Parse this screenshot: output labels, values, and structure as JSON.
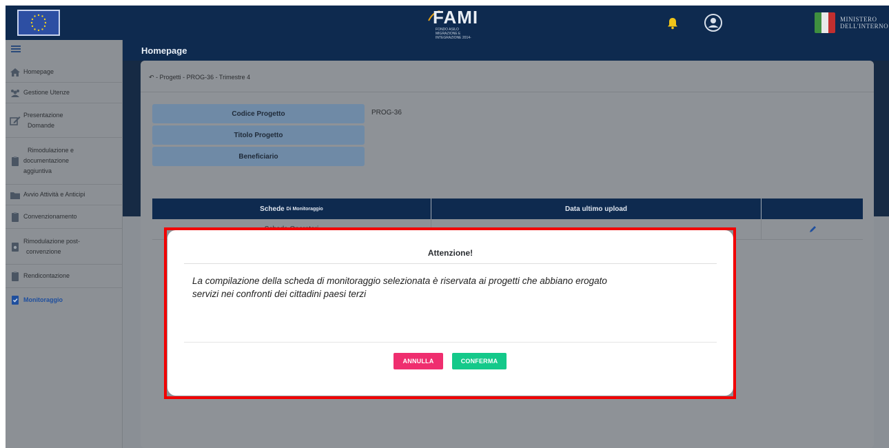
{
  "topbar": {
    "logo_text": "FAMI",
    "logo_subtext": "FONDO ASILO MIGRAZIONE E INTEGRAZIONE 2014-2020",
    "ministry_line1": "MINISTERO",
    "ministry_line2": "DELL'INTERNO",
    "colors": {
      "bar": "#0e2a4f",
      "bell": "#f0c419"
    }
  },
  "sidebar": {
    "items": [
      {
        "label": "Homepage",
        "icon": "home-icon"
      },
      {
        "label": "Gestione Utenze",
        "icon": "users-icon"
      },
      {
        "label_lines": [
          "Presentazione",
          "Domande"
        ],
        "icon": "edit-icon"
      },
      {
        "label_lines": [
          "Rimodulazione e",
          "documentazione",
          "aggiuntiva"
        ],
        "icon": "clipboard-icon"
      },
      {
        "label": "Avvio Attività e Anticipi",
        "icon": "folder-icon"
      },
      {
        "label": "Convenzionamento",
        "icon": "clipboard-icon"
      },
      {
        "label_lines": [
          "Rimodulazione post-",
          "convenzione"
        ],
        "icon": "clipboard-gear-icon"
      },
      {
        "label": "Rendicontazione",
        "icon": "clipboard-icon"
      },
      {
        "label": "Monitoraggio",
        "icon": "clipboard-check-icon",
        "active": true
      }
    ]
  },
  "main": {
    "page_title": "Homepage",
    "breadcrumb": "- Progetti - PROG-36 - Trimestre 4",
    "info": [
      {
        "label": "Codice Progetto",
        "value": "PROG-36"
      },
      {
        "label": "Titolo Progetto",
        "value": ""
      },
      {
        "label": "Beneficiario",
        "value": ""
      }
    ],
    "table": {
      "headers": [
        "Schede",
        "Di Monitoraggio",
        "Data ultimo upload",
        ""
      ],
      "rows": [
        {
          "scheda": "Scheda Operatori",
          "data": "--"
        }
      ]
    }
  },
  "modal": {
    "title": "Attenzione!",
    "body_line1": "La compilazione della scheda di monitoraggio selezionata è riservata ai progetti che abbiano erogato",
    "body_line2": "servizi nei confronti dei cittadini paesi terzi",
    "cancel_label": "ANNULLA",
    "confirm_label": "CONFERMA",
    "colors": {
      "cancel": "#ef2e6f",
      "confirm": "#14c98a",
      "highlight": "#f20000"
    }
  }
}
